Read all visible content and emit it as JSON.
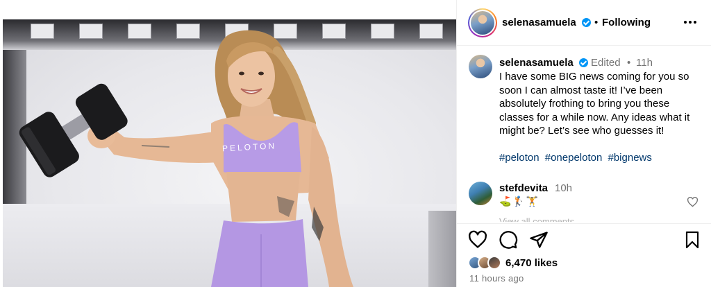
{
  "post": {
    "author": "selenasamuela",
    "follow_state": "Following",
    "header_separator": "•",
    "photo_brand_text": "PELOTON"
  },
  "caption": {
    "author": "selenasamuela",
    "edited_label": "Edited",
    "separator": "•",
    "time": "11h",
    "text": "I have some BIG news coming for you so soon I can almost taste it! I’ve been absolutely frothing to bring you these classes for a while now. Any ideas what it might be? Let’s see who guesses it!",
    "hashtags": [
      "#peloton",
      "#onepeloton",
      "#bignews"
    ]
  },
  "comment": {
    "author": "stefdevita",
    "time": "10h",
    "text": "⛳🏌️🏋️",
    "next_hint": "View all comments"
  },
  "actions": {
    "likes": "6,470 likes",
    "posted_ago": "11 hours ago"
  },
  "icons": {
    "more": "more-horizontal-icon",
    "verified": "verified-badge-icon",
    "like": "heart-icon",
    "comment": "comment-bubble-icon",
    "share": "paper-plane-icon",
    "save": "bookmark-icon"
  },
  "colors": {
    "verified": "#0095f6",
    "hashtag": "#00376b",
    "muted_text": "#737373",
    "outfit": "#b79be6"
  }
}
